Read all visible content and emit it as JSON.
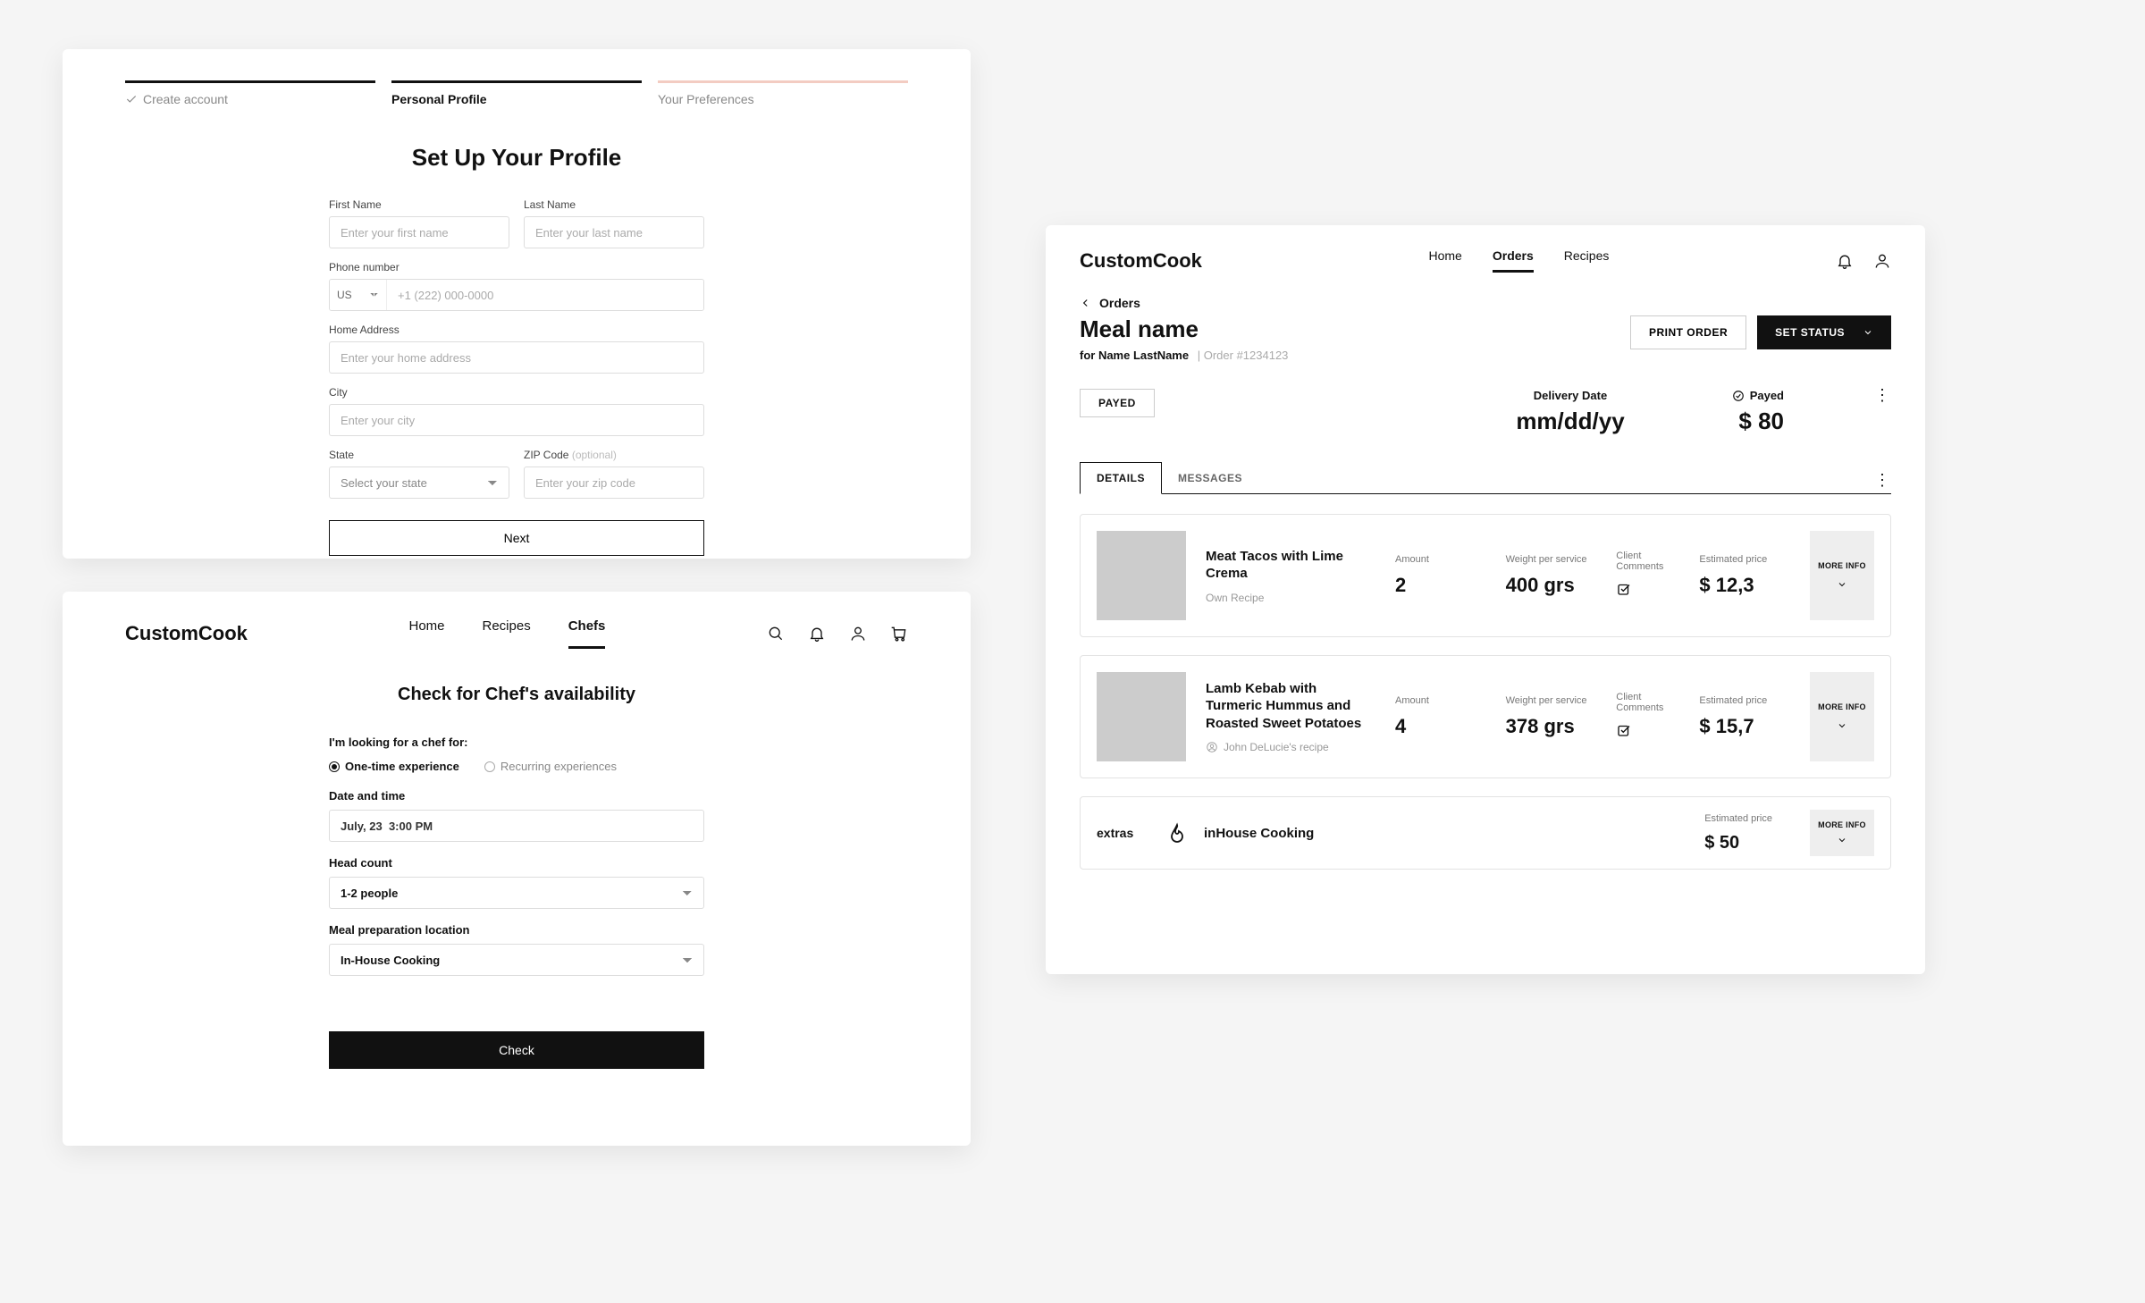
{
  "profile": {
    "steps": [
      "Create account",
      "Personal Profile",
      "Your Preferences"
    ],
    "title": "Set Up Your Profile",
    "firstNameLabel": "First Name",
    "firstNamePh": "Enter your first name",
    "lastNameLabel": "Last Name",
    "lastNamePh": "Enter your last name",
    "phoneLabel": "Phone number",
    "cc": "US",
    "phonePh": "+1 (222) 000-0000",
    "addrLabel": "Home Address",
    "addrPh": "Enter your home address",
    "cityLabel": "City",
    "cityPh": "Enter your city",
    "stateLabel": "State",
    "statePh": "Select your state",
    "zipLabel": "ZIP Code",
    "zipOpt": "(optional)",
    "zipPh": "Enter your zip code",
    "nextBtn": "Next"
  },
  "chef": {
    "brand": "CustomCook",
    "nav": [
      "Home",
      "Recipes",
      "Chefs"
    ],
    "title": "Check for Chef's availability",
    "lookingLabel": "I'm looking for a chef for:",
    "radio1": "One-time experience",
    "radio2": "Recurring experiences",
    "dateLabel": "Date and time",
    "dateVal": "July, 23  3:00 PM",
    "headLabel": "Head count",
    "headVal": "1-2 people",
    "locLabel": "Meal preparation location",
    "locVal": "In-House Cooking",
    "checkBtn": "Check"
  },
  "order": {
    "brand": "CustomCook",
    "nav": [
      "Home",
      "Orders",
      "Recipes"
    ],
    "backLabel": "Orders",
    "title": "Meal name",
    "for": "for Name LastName",
    "orderId": "Order #1234123",
    "printBtn": "PRINT ORDER",
    "statusBtn": "SET STATUS",
    "chip": "PAYED",
    "deliveryLabel": "Delivery Date",
    "deliveryVal": "mm/dd/yy",
    "payedLabel": "Payed",
    "payedVal": "$ 80",
    "tabs": [
      "DETAILS",
      "MESSAGES"
    ],
    "amountLabel": "Amount",
    "weightLabel": "Weight per service",
    "commentsLabel": "Client Comments",
    "priceLabel": "Estimated price",
    "moreInfo": "MORE INFO",
    "items": [
      {
        "name": "Meat Tacos with Lime Crema",
        "recipe": "Own Recipe",
        "recipeIcon": false,
        "amount": "2",
        "weight": "400 grs",
        "price": "$ 12,3"
      },
      {
        "name": "Lamb Kebab with Turmeric Hummus and Roasted Sweet Potatoes",
        "recipe": "John DeLucie's recipe",
        "recipeIcon": true,
        "amount": "4",
        "weight": "378 grs",
        "price": "$ 15,7"
      }
    ],
    "extrasLabel": "extras",
    "extrasName": "inHouse Cooking",
    "extrasPrice": "$ 50"
  }
}
